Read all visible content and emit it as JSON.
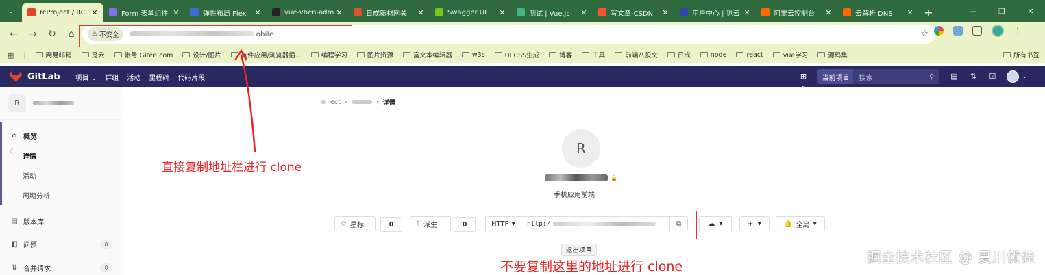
{
  "browser": {
    "tabs": [
      {
        "label": "rcProject / RC",
        "color": "#e24329",
        "active": true
      },
      {
        "label": "Form 表单组件",
        "color": "#8a6cf0"
      },
      {
        "label": "弹性布局 Flex",
        "color": "#3b6fd6"
      },
      {
        "label": "vue-vben-adm",
        "color": "#222222"
      },
      {
        "label": "日成新材网关",
        "color": "#d5542f"
      },
      {
        "label": "Swagger UI",
        "color": "#7fc31c"
      },
      {
        "label": "测试 | Vue.js",
        "color": "#41b883"
      },
      {
        "label": "写文章-CSDN",
        "color": "#fc5531"
      },
      {
        "label": "用户中心 | 觅云",
        "color": "#3344aa"
      },
      {
        "label": "阿里云控制台",
        "color": "#ff6a00"
      },
      {
        "label": "云解析 DNS",
        "color": "#ff6a00"
      }
    ],
    "security_label": "不安全",
    "url_suffix": "obile",
    "bookmarks": [
      "网易邮箱",
      "觅云",
      "帐号 Gitee.com",
      "设计/图片",
      "软件应用/浏览器插...",
      "编程学习",
      "图片资源",
      "富文本编辑器",
      "w3s",
      "UI CSS生成",
      "博客",
      "工具",
      "前端八股文",
      "日成",
      "node",
      "react",
      "vue学习",
      "源码集"
    ],
    "bookmarks_right": "所有书签"
  },
  "gitlab": {
    "brand": "GitLab",
    "nav": [
      "项目 ⌄",
      "群组",
      "活动",
      "里程碑",
      "代码片段"
    ],
    "search_scope": "当前项目",
    "search_placeholder": "搜索"
  },
  "sidebar": {
    "avatar_letter": "R",
    "overview": "概览",
    "details": "详情",
    "activity": "活动",
    "cycle": "周期分析",
    "repo": "版本库",
    "issues": "问题",
    "issues_count": "0",
    "merge": "合并请求",
    "merge_count": "0"
  },
  "main": {
    "crumb_a": "ect",
    "crumb_c": "详情",
    "avatar_letter": "R",
    "description": "手机应用前端",
    "star_label": "星标",
    "star_count": "0",
    "fork_label": "派生",
    "fork_count": "0",
    "protocol": "HTTP",
    "clone_url_prefix": "http:/",
    "notify_label": "全局",
    "tooltip": "退出项目"
  },
  "annotations": {
    "top": "直接复制地址栏进行 clone",
    "bottom": "不要复制这里的地址进行 clone",
    "color": "#e22222"
  },
  "watermark": "掘金技术社区 @ 夏川优佳"
}
